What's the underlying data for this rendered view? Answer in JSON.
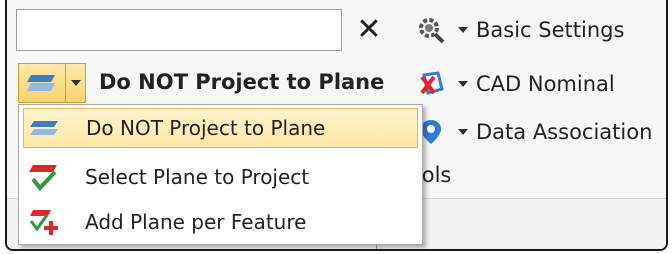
{
  "search": {
    "value": "",
    "placeholder": "",
    "clear_glyph": "✕"
  },
  "projection": {
    "current": "Do NOT Project to Plane",
    "icon": "plane-projection-icon",
    "options": [
      {
        "label": "Do NOT Project to Plane",
        "icon": "plane-icon",
        "selected": true
      },
      {
        "label": "Select Plane to Project",
        "icon": "plane-check-icon",
        "selected": false
      },
      {
        "label": "Add Plane per Feature",
        "icon": "plane-add-icon",
        "selected": false
      }
    ]
  },
  "ribbon": {
    "basic_settings": "Basic Settings",
    "cad_nominal": "CAD Nominal",
    "data_association": "Data Association",
    "group_label_partial": "ntrols"
  },
  "colors": {
    "highlight": "#fde7a3",
    "highlight_border": "#e2b750",
    "accent_blue": "#2f7fd8",
    "accent_red": "#e02626"
  }
}
